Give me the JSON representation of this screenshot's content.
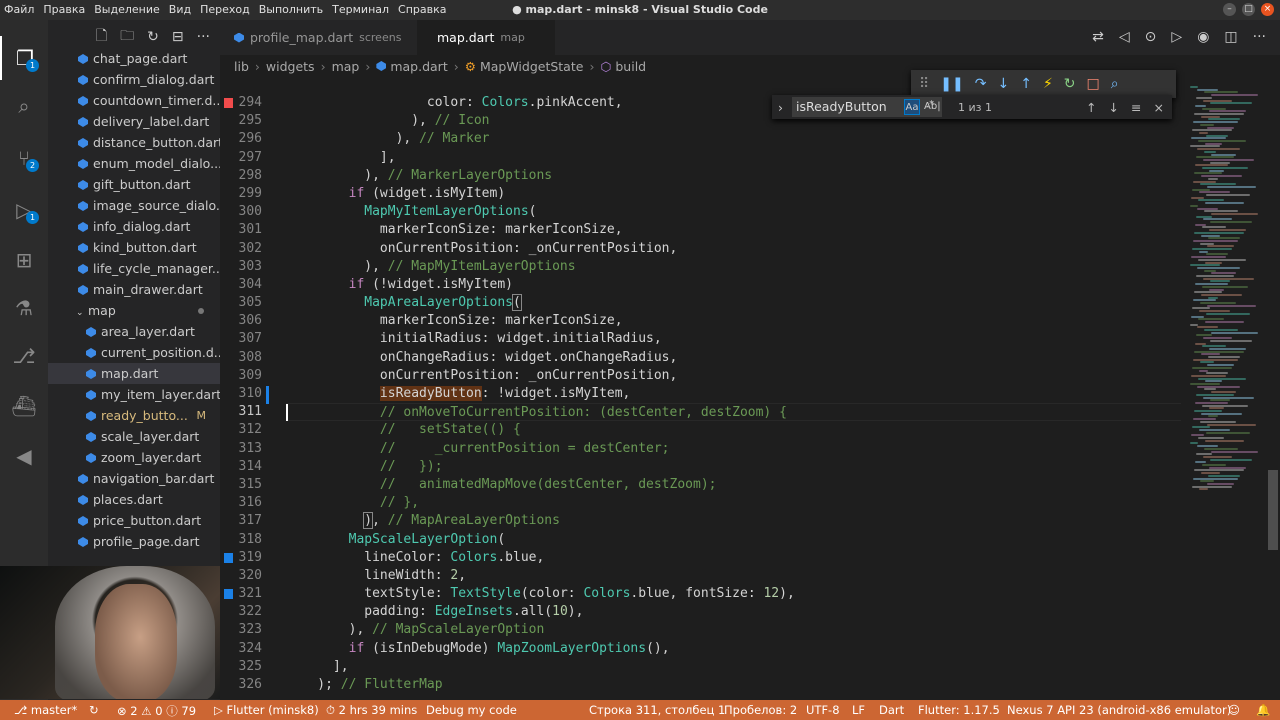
{
  "titlebar": {
    "menu": [
      "Файл",
      "Правка",
      "Выделение",
      "Вид",
      "Переход",
      "Выполнить",
      "Терминал",
      "Справка"
    ],
    "title": "● map.dart - minsk8 - Visual Studio Code"
  },
  "activity": {
    "explorer_badge": "1",
    "scm_badge": "2",
    "debug_badge": "1"
  },
  "sidebar": {
    "files": [
      {
        "name": "chat_page.dart",
        "indent": 1
      },
      {
        "name": "confirm_dialog.dart",
        "indent": 1
      },
      {
        "name": "countdown_timer.d...",
        "indent": 1
      },
      {
        "name": "delivery_label.dart",
        "indent": 1
      },
      {
        "name": "distance_button.dart",
        "indent": 1
      },
      {
        "name": "enum_model_dialo...",
        "indent": 1
      },
      {
        "name": "gift_button.dart",
        "indent": 1
      },
      {
        "name": "image_source_dialo...",
        "indent": 1
      },
      {
        "name": "info_dialog.dart",
        "indent": 1
      },
      {
        "name": "kind_button.dart",
        "indent": 1
      },
      {
        "name": "life_cycle_manager....",
        "indent": 1
      },
      {
        "name": "main_drawer.dart",
        "indent": 1
      },
      {
        "name": "map",
        "indent": 0,
        "folder": true
      },
      {
        "name": "area_layer.dart",
        "indent": 2
      },
      {
        "name": "current_position.d...",
        "indent": 2
      },
      {
        "name": "map.dart",
        "indent": 2,
        "selected": true
      },
      {
        "name": "my_item_layer.dart",
        "indent": 2
      },
      {
        "name": "ready_butto...",
        "indent": 2,
        "status": "M"
      },
      {
        "name": "scale_layer.dart",
        "indent": 2
      },
      {
        "name": "zoom_layer.dart",
        "indent": 2
      },
      {
        "name": "navigation_bar.dart",
        "indent": 1
      },
      {
        "name": "places.dart",
        "indent": 1
      },
      {
        "name": "price_button.dart",
        "indent": 1
      },
      {
        "name": "profile_page.dart",
        "indent": 1
      }
    ]
  },
  "tabs": [
    {
      "label": "profile_map.dart",
      "desc": "screens",
      "active": false
    },
    {
      "label": "map.dart",
      "desc": "map",
      "active": true
    }
  ],
  "breadcrumb": [
    "lib",
    "widgets",
    "map",
    "map.dart",
    "MapWidgetState",
    "build"
  ],
  "find": {
    "query": "isReadyButton",
    "opt1": "Aa",
    "opt2": "Ab|",
    "opt3": ".*",
    "result": "1 из 1"
  },
  "editor": {
    "line_numbers": [
      294,
      295,
      296,
      297,
      298,
      299,
      300,
      301,
      302,
      303,
      304,
      305,
      306,
      307,
      308,
      309,
      310,
      311,
      312,
      313,
      314,
      315,
      316,
      317,
      318,
      319,
      320,
      321,
      322,
      323,
      324,
      325,
      326
    ],
    "current_line": 311,
    "lines": [
      [
        [
          "    ",
          "t"
        ],
        [
          "                  color: ",
          "t"
        ],
        [
          "Colors",
          "cls"
        ],
        [
          ".pinkAccent,",
          "t"
        ]
      ],
      [
        [
          "                ), ",
          "t"
        ],
        [
          "// Icon",
          "c"
        ]
      ],
      [
        [
          "              ), ",
          "t"
        ],
        [
          "// Marker",
          "c"
        ]
      ],
      [
        [
          "            ],",
          "t"
        ]
      ],
      [
        [
          "          ), ",
          "t"
        ],
        [
          "// MarkerLayerOptions",
          "c"
        ]
      ],
      [
        [
          "        ",
          "t"
        ],
        [
          "if",
          "kw"
        ],
        [
          " (widget.isMyItem)",
          "t"
        ]
      ],
      [
        [
          "          ",
          "t"
        ],
        [
          "MapMyItemLayerOptions",
          "cls"
        ],
        [
          "(",
          "t"
        ]
      ],
      [
        [
          "            markerIconSize: markerIconSize,",
          "t"
        ]
      ],
      [
        [
          "            onCurrentPosition: _onCurrentPosition,",
          "t"
        ]
      ],
      [
        [
          "          ), ",
          "t"
        ],
        [
          "// MapMyItemLayerOptions",
          "c"
        ]
      ],
      [
        [
          "        ",
          "t"
        ],
        [
          "if",
          "kw"
        ],
        [
          " (!widget.isMyItem)",
          "t"
        ]
      ],
      [
        [
          "          ",
          "t"
        ],
        [
          "MapAreaLayerOptions",
          "cls"
        ],
        [
          "(",
          "br"
        ]
      ],
      [
        [
          "            markerIconSize: markerIconSize,",
          "t"
        ]
      ],
      [
        [
          "            initialRadius: widget.initialRadius,",
          "t"
        ]
      ],
      [
        [
          "            onChangeRadius: widget.onChangeRadius,",
          "t"
        ]
      ],
      [
        [
          "            onCurrentPosition: _onCurrentPosition,",
          "t"
        ]
      ],
      [
        [
          "            ",
          "t"
        ],
        [
          "isReadyButton",
          "hl"
        ],
        [
          ": !widget.isMyItem,",
          "t"
        ]
      ],
      [
        [
          "            ",
          "t"
        ],
        [
          "// onMoveToCurrentPosition: (destCenter, destZoom) {",
          "c"
        ]
      ],
      [
        [
          "            ",
          "t"
        ],
        [
          "//   setState(() {",
          "c"
        ]
      ],
      [
        [
          "            ",
          "t"
        ],
        [
          "//     _currentPosition = destCenter;",
          "c"
        ]
      ],
      [
        [
          "            ",
          "t"
        ],
        [
          "//   });",
          "c"
        ]
      ],
      [
        [
          "            ",
          "t"
        ],
        [
          "//   animatedMapMove(destCenter, destZoom);",
          "c"
        ]
      ],
      [
        [
          "            ",
          "t"
        ],
        [
          "// },",
          "c"
        ]
      ],
      [
        [
          "          ",
          "t"
        ],
        [
          ")",
          "br"
        ],
        [
          ", ",
          "t"
        ],
        [
          "// MapAreaLayerOptions",
          "c"
        ]
      ],
      [
        [
          "        ",
          "t"
        ],
        [
          "MapScaleLayerOption",
          "cls"
        ],
        [
          "(",
          "t"
        ]
      ],
      [
        [
          "          lineColor: ",
          "t"
        ],
        [
          "Colors",
          "cls"
        ],
        [
          ".blue,",
          "t"
        ]
      ],
      [
        [
          "          lineWidth: ",
          "t"
        ],
        [
          "2",
          "n"
        ],
        [
          ",",
          "t"
        ]
      ],
      [
        [
          "          textStyle: ",
          "t"
        ],
        [
          "TextStyle",
          "cls"
        ],
        [
          "(color: ",
          "t"
        ],
        [
          "Colors",
          "cls"
        ],
        [
          ".blue, fontSize: ",
          "t"
        ],
        [
          "12",
          "n"
        ],
        [
          "),",
          "t"
        ]
      ],
      [
        [
          "          padding: ",
          "t"
        ],
        [
          "EdgeInsets",
          "cls"
        ],
        [
          ".all(",
          "t"
        ],
        [
          "10",
          "n"
        ],
        [
          "),",
          "t"
        ]
      ],
      [
        [
          "        ), ",
          "t"
        ],
        [
          "// MapScaleLayerOption",
          "c"
        ]
      ],
      [
        [
          "        ",
          "t"
        ],
        [
          "if",
          "kw"
        ],
        [
          " (isInDebugMode) ",
          "t"
        ],
        [
          "MapZoomLayerOptions",
          "cls"
        ],
        [
          "(),",
          "t"
        ]
      ],
      [
        [
          "      ],",
          "t"
        ]
      ],
      [
        [
          "    ); ",
          "t"
        ],
        [
          "// FlutterMap",
          "c"
        ]
      ]
    ],
    "gutter_marks": {
      "294": "#f14c4c",
      "319": "#1b81e7",
      "321": "#1b81e7"
    }
  },
  "statusbar": {
    "branch": "master*",
    "errors": "2",
    "warnings": "0",
    "info": "79",
    "flutter": "Flutter (minsk8)",
    "time": "2 hrs 39 mins",
    "debug": "Debug my code",
    "position": "Строка 311, столбец 1",
    "spaces": "Пробелов: 2",
    "encoding": "UTF-8",
    "eol": "LF",
    "lang": "Dart",
    "flutter_ver": "Flutter: 1.17.5",
    "device": "Nexus 7 API 23 (android-x86 emulator)"
  },
  "colors": {
    "statusbar": "#cc6633",
    "accent": "#007acc",
    "keyword": "#c586c0",
    "class": "#4ec9b0",
    "comment": "#6a9955",
    "number": "#b5cea8"
  }
}
